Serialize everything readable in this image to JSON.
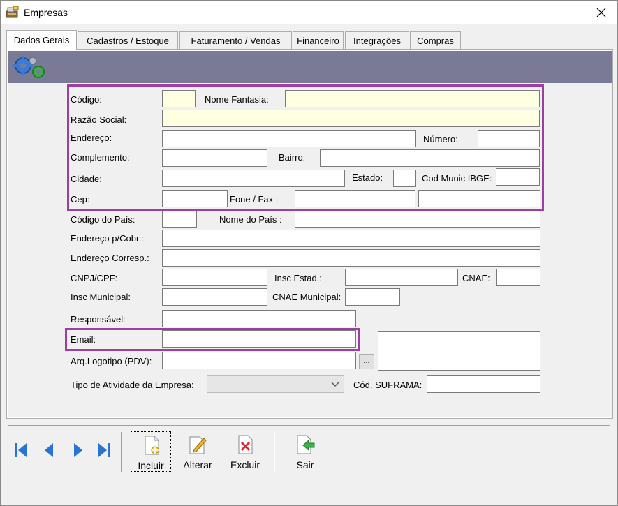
{
  "window": {
    "title": "Empresas"
  },
  "icons": {
    "app": "cash-register-icon",
    "close": "close-icon",
    "banner": "gears-icon"
  },
  "tabs": [
    {
      "label": "Dados Gerais",
      "active": true
    },
    {
      "label": "Cadastros / Estoque"
    },
    {
      "label": "Faturamento / Vendas"
    },
    {
      "label": "Financeiro"
    },
    {
      "label": "Integrações"
    },
    {
      "label": "Compras"
    }
  ],
  "form": {
    "codigo": {
      "label": "Código:",
      "value": ""
    },
    "nome_fantasia": {
      "label": "Nome Fantasia:",
      "value": ""
    },
    "razao_social": {
      "label": "Razão Social:",
      "value": ""
    },
    "endereco": {
      "label": "Endereço:",
      "value": ""
    },
    "numero": {
      "label": "Número:",
      "value": ""
    },
    "complemento": {
      "label": "Complemento:",
      "value": ""
    },
    "bairro": {
      "label": "Bairro:",
      "value": ""
    },
    "cidade": {
      "label": "Cidade:",
      "value": ""
    },
    "estado": {
      "label": "Estado:",
      "value": ""
    },
    "cod_munic_ibge": {
      "label": "Cod Munic IBGE:",
      "value": ""
    },
    "cep": {
      "label": "Cep:",
      "value": ""
    },
    "fone_fax": {
      "label": "Fone / Fax :",
      "value1": "",
      "value2": ""
    },
    "codigo_pais": {
      "label": "Código do País:",
      "value": ""
    },
    "nome_pais": {
      "label": "Nome do País :",
      "value": ""
    },
    "endereco_cobr": {
      "label": "Endereço p/Cobr.:",
      "value": ""
    },
    "endereco_corresp": {
      "label": "Endereço Corresp.:",
      "value": ""
    },
    "cnpj_cpf": {
      "label": "CNPJ/CPF:",
      "value": ""
    },
    "insc_estad": {
      "label": "Insc Estad.:",
      "value": ""
    },
    "cnae": {
      "label": "CNAE:",
      "value": ""
    },
    "insc_municipal": {
      "label": "Insc Municipal:",
      "value": ""
    },
    "cnae_municipal": {
      "label": "CNAE Municipal:",
      "value": ""
    },
    "responsavel": {
      "label": "Responsável:",
      "value": ""
    },
    "email": {
      "label": "Email:",
      "value": ""
    },
    "arq_logotipo": {
      "label": "Arq.Logotipo (PDV):",
      "value": "",
      "browse_label": "..."
    },
    "tipo_atividade": {
      "label": "Tipo de Atividade da Empresa:",
      "value": ""
    },
    "cod_suframa": {
      "label": "Cód. SUFRAMA:",
      "value": ""
    }
  },
  "highlight_color": "#9b3fa5",
  "toolbar": {
    "first": "first-record-icon",
    "prev": "previous-record-icon",
    "next": "next-record-icon",
    "last": "last-record-icon",
    "incluir": "Incluir",
    "alterar": "Alterar",
    "excluir": "Excluir",
    "sair": "Sair"
  }
}
